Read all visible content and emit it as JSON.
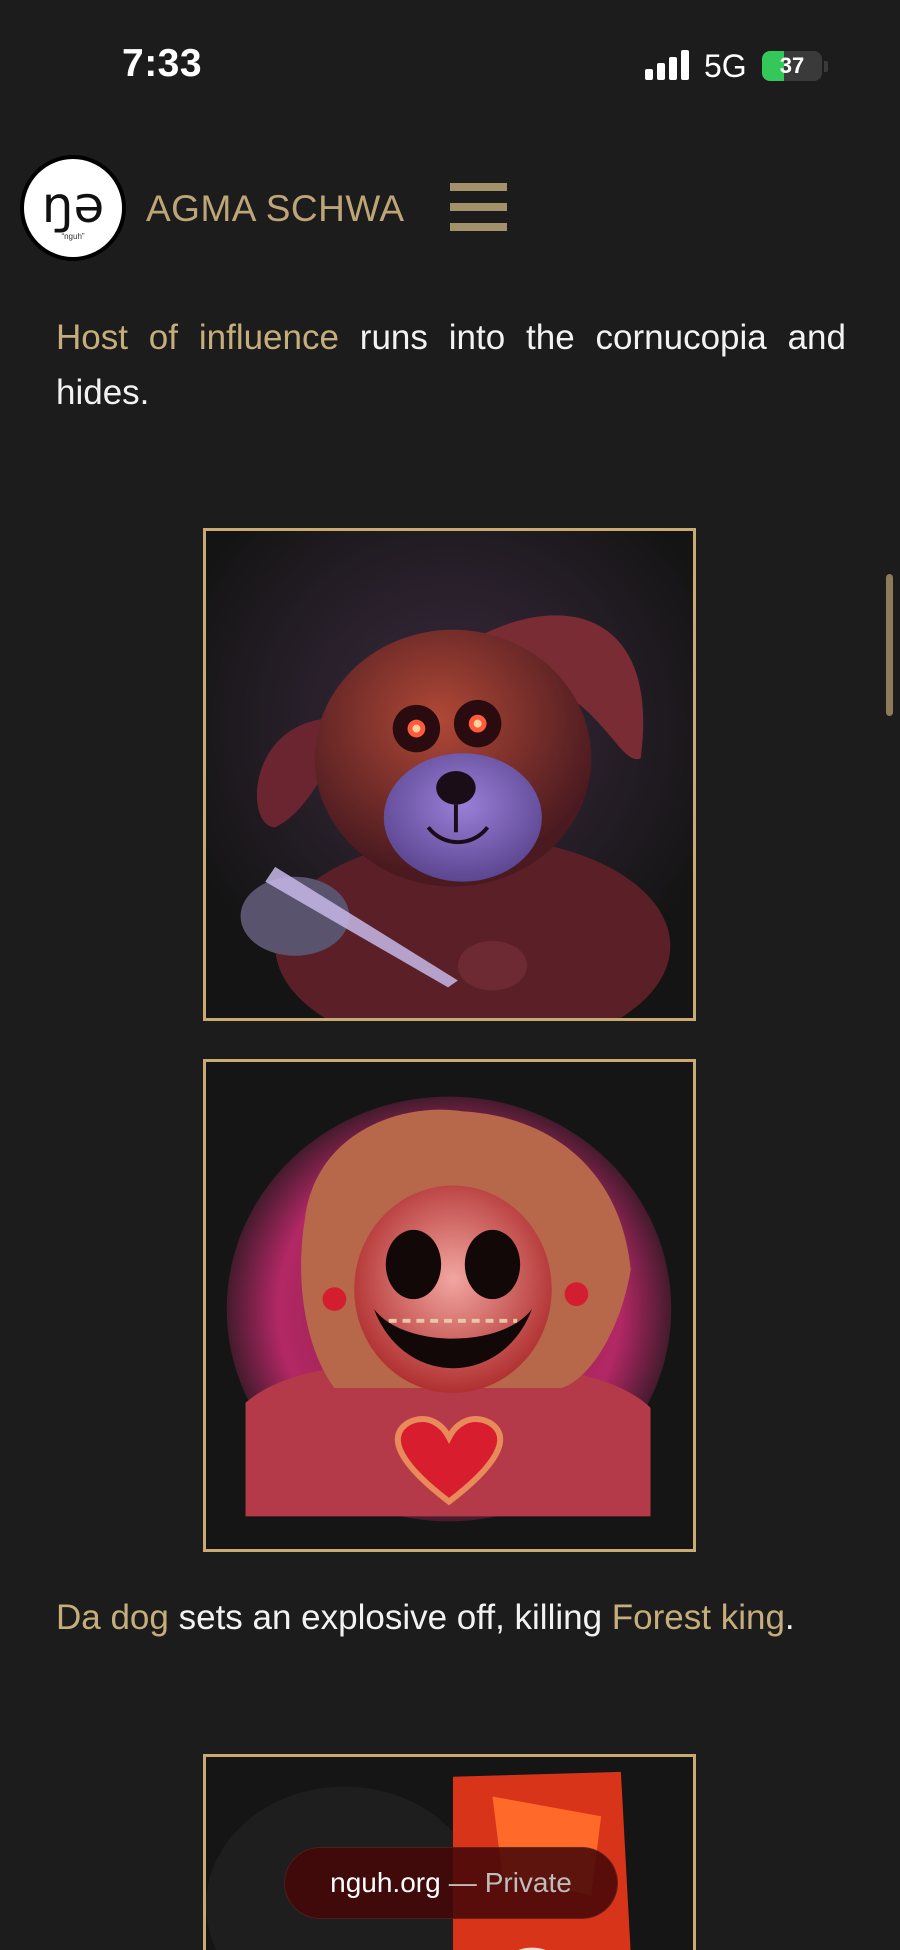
{
  "status_bar": {
    "time": "7:33",
    "network": "5G",
    "battery": "37",
    "icons": [
      "signal-icon",
      "battery-icon"
    ]
  },
  "header": {
    "logo_glyph": "ŋə",
    "logo_caption": "“nguh”",
    "site_title": "AGMA SCHWA",
    "menu_icon": "hamburger-menu-icon"
  },
  "content": {
    "paragraph_1": {
      "link": "Host of influence",
      "text": " runs into the cornucopia and hides."
    },
    "images": [
      {
        "depicts": "plush dog with glowing red eyes holding a knife"
      },
      {
        "depicts": "ragdoll clown with heart on sweater"
      },
      {
        "depicts": "red and dark creature (partially visible)"
      }
    ],
    "paragraph_2": {
      "link_1": "Da dog",
      "text_1": " sets an explosive off, killing ",
      "link_2": "Forest king",
      "text_2": "."
    }
  },
  "browser": {
    "domain": "nguh.org",
    "separator": "—",
    "mode": "Private"
  },
  "colors": {
    "background": "#1c1c1c",
    "accent": "#c6ad7c",
    "frame_border": "#c8aa72",
    "text": "#f2f2f2"
  }
}
